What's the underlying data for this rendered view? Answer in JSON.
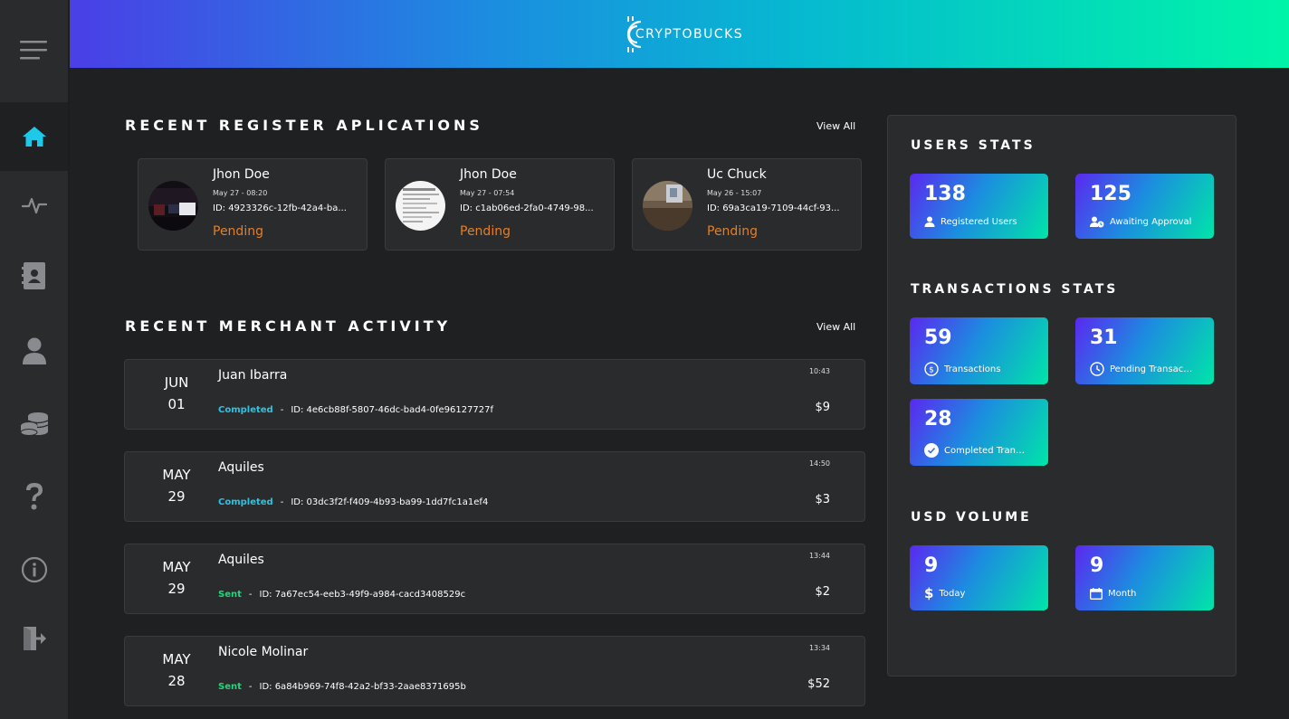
{
  "brand": {
    "name": "CRYPTOBUCKS",
    "header_gradient": [
      "#4a3fe6",
      "#00f5a8"
    ]
  },
  "sidebar": {
    "items": [
      {
        "icon": "home-icon",
        "active": true
      },
      {
        "icon": "activity-icon",
        "active": false
      },
      {
        "icon": "contacts-book-icon",
        "active": false
      },
      {
        "icon": "user-icon",
        "active": false
      },
      {
        "icon": "coins-stack-icon",
        "active": false
      },
      {
        "icon": "question-icon",
        "active": false
      },
      {
        "icon": "info-icon",
        "active": false
      },
      {
        "icon": "logout-icon",
        "active": false
      }
    ],
    "active_color": "#1ec8e8"
  },
  "applications": {
    "title": "RECENT REGISTER APLICATIONS",
    "view_all": "View All",
    "items": [
      {
        "name": "Jhon Doe",
        "date": "May 27 - 08:20",
        "id": "ID: 4923326c-12fb-42a4-ba...",
        "status": "Pending"
      },
      {
        "name": "Jhon Doe",
        "date": "May 27 - 07:54",
        "id": "ID: c1ab06ed-2fa0-4749-98...",
        "status": "Pending"
      },
      {
        "name": "Uc Chuck",
        "date": "May 26 - 15:07",
        "id": "ID: 69a3ca19-7109-44cf-93...",
        "status": "Pending"
      }
    ]
  },
  "merchant": {
    "title": "RECENT MERCHANT ACTIVITY",
    "view_all": "View All",
    "rows": [
      {
        "month": "JUN",
        "day": "01",
        "name": "Juan Ibarra",
        "time": "10:43",
        "status": "Completed",
        "sep": "-",
        "id": "ID: 4e6cb88f-5807-46dc-bad4-0fe96127727f",
        "amount": "$9"
      },
      {
        "month": "MAY",
        "day": "29",
        "name": "Aquiles",
        "time": "14:50",
        "status": "Completed",
        "sep": "-",
        "id": "ID: 03dc3f2f-f409-4b93-ba99-1dd7fc1a1ef4",
        "amount": "$3"
      },
      {
        "month": "MAY",
        "day": "29",
        "name": "Aquiles",
        "time": "13:44",
        "status": "Sent",
        "sep": "-",
        "id": "ID: 7a67ec54-eeb3-49f9-a984-cacd3408529c",
        "amount": "$2"
      },
      {
        "month": "MAY",
        "day": "28",
        "name": "Nicole Molinar",
        "time": "13:34",
        "status": "Sent",
        "sep": "-",
        "id": "ID: 6a84b969-74f8-42a2-bf33-2aae8371695b",
        "amount": "$52"
      }
    ]
  },
  "stats": {
    "users_title": "USERS STATS",
    "users": [
      {
        "value": "138",
        "label": "Registered Users",
        "icon": "user-icon"
      },
      {
        "value": "125",
        "label": "Awaiting Approval",
        "icon": "user-clock-icon"
      }
    ],
    "transactions_title": "TRANSACTIONS STATS",
    "transactions": [
      {
        "value": "59",
        "label": "Transactions",
        "icon": "dollar-circle-icon"
      },
      {
        "value": "31",
        "label": "Pending Transactions",
        "icon": "clock-icon"
      },
      {
        "value": "28",
        "label": "Completed Transactions",
        "icon": "check-circle-icon"
      }
    ],
    "volume_title": "USD VOLUME",
    "volume": [
      {
        "value": "9",
        "label": "Today",
        "icon": "dollar-icon"
      },
      {
        "value": "9",
        "label": "Month",
        "icon": "calendar-icon"
      }
    ],
    "card_gradient": [
      "#5a28f0",
      "#00e5a8"
    ]
  }
}
